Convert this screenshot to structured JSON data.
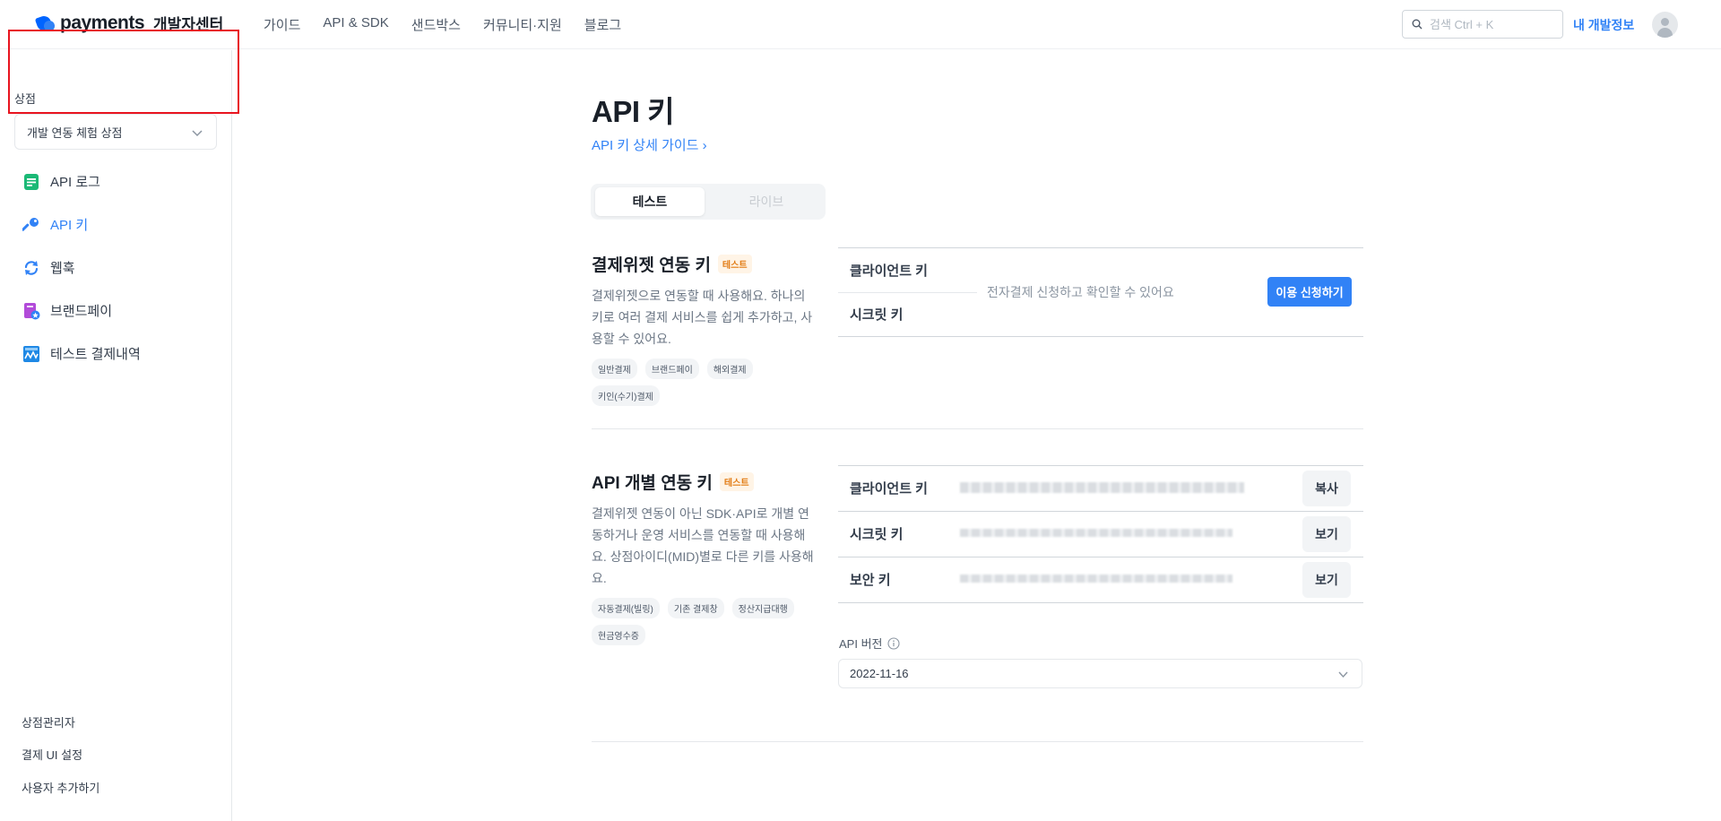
{
  "header": {
    "logo_text": "payments",
    "logo_sub": "개발자센터",
    "nav": [
      "가이드",
      "API & SDK",
      "샌드박스",
      "커뮤니티·지원",
      "블로그"
    ],
    "search_placeholder": "검색 Ctrl + K",
    "my_dev": "내 개발정보"
  },
  "sidebar": {
    "store_label": "상점",
    "store_selected": "개발 연동 체험 상점",
    "items": [
      {
        "label": "API 로그",
        "icon": "document-icon"
      },
      {
        "label": "API 키",
        "icon": "key-icon",
        "active": true
      },
      {
        "label": "웹훅",
        "icon": "refresh-icon"
      },
      {
        "label": "브랜드페이",
        "icon": "brandpay-icon"
      },
      {
        "label": "테스트 결제내역",
        "icon": "chart-icon"
      }
    ],
    "bottom_links": [
      "상점관리자",
      "결제 UI 설정",
      "사용자 추가하기"
    ]
  },
  "main": {
    "title": "API 키",
    "guide_link": "API 키 상세 가이드 ›",
    "tabs": [
      {
        "label": "테스트",
        "selected": true
      },
      {
        "label": "라이브",
        "selected": false
      }
    ],
    "widget": {
      "title": "결제위젯 연동 키",
      "badge": "테스트",
      "desc": "결제위젯으로 연동할 때 사용해요. 하나의 키로 여러 결제 서비스를 쉽게 추가하고, 사용할 수 있어요.",
      "chips": [
        "일반결제",
        "브랜드페이",
        "해외결제",
        "키인(수기)결제"
      ],
      "client_key_label": "클라이언트 키",
      "secret_key_label": "시크릿 키",
      "note": "전자결제 신청하고 확인할 수 있어요",
      "apply_button": "이용 신청하기"
    },
    "api": {
      "title": "API 개별 연동 키",
      "badge": "테스트",
      "desc": "결제위젯 연동이 아닌 SDK·API로 개별 연동하거나 운영 서비스를 연동할 때 사용해요. 상점아이디(MID)별로 다른 키를 사용해요.",
      "chips": [
        "자동결제(빌링)",
        "기존 결제창",
        "정산지급대행",
        "현금영수증"
      ],
      "rows": [
        {
          "label": "클라이언트 키",
          "button": "복사"
        },
        {
          "label": "시크릿 키",
          "button": "보기"
        },
        {
          "label": "보안 키",
          "button": "보기"
        }
      ],
      "version_label": "API 버전",
      "version_value": "2022-11-16"
    }
  },
  "colors": {
    "accent": "#3182f6",
    "highlight_box": "#e8141f",
    "badge": "#e27b13"
  }
}
